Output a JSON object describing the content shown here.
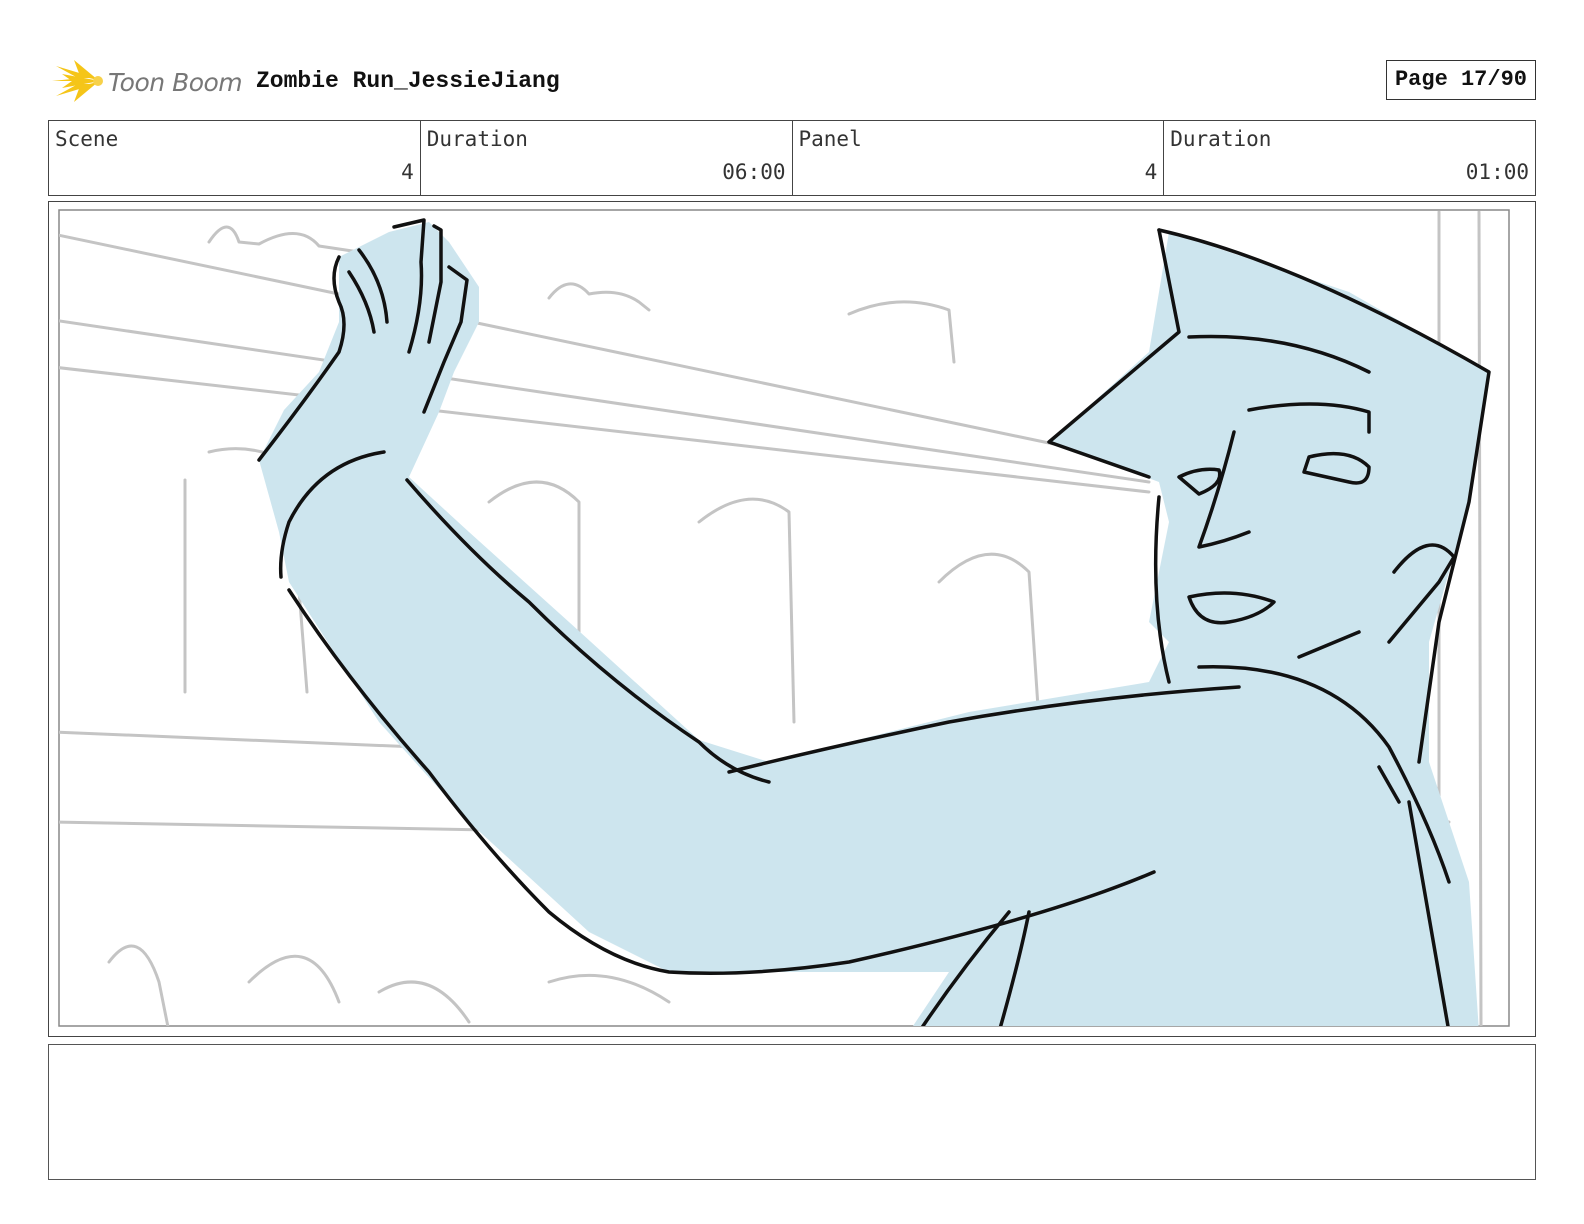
{
  "header": {
    "logo_text": "Toon Boom",
    "project_title": "Zombie Run_JessieJiang",
    "page_label": "Page 17/90"
  },
  "info_table": [
    {
      "label": "Scene",
      "value": "4"
    },
    {
      "label": "Duration",
      "value": "06:00"
    },
    {
      "label": "Panel",
      "value": "4"
    },
    {
      "label": "Duration",
      "value": "01:00"
    }
  ],
  "panel": {
    "icon": "storyboard-sketch-image",
    "fill_color": "#cde5ee",
    "line_color": "#111111",
    "background_line_color": "#c4c4c4"
  },
  "notes": {
    "text": ""
  }
}
